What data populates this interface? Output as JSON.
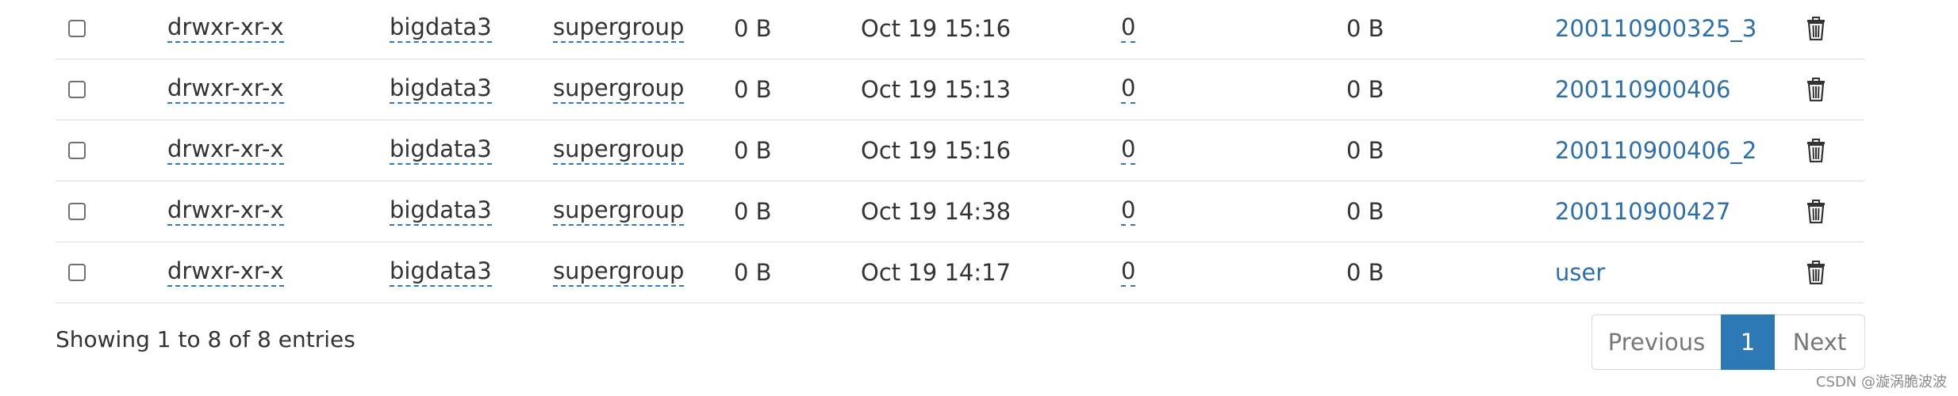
{
  "rows": [
    {
      "permission": "drwxr-xr-x",
      "owner": "bigdata3",
      "group": "supergroup",
      "size": "0 B",
      "modified": "Oct 19 15:16",
      "replication": "0",
      "block_size": "0 B",
      "name": "200110900325_3"
    },
    {
      "permission": "drwxr-xr-x",
      "owner": "bigdata3",
      "group": "supergroup",
      "size": "0 B",
      "modified": "Oct 19 15:13",
      "replication": "0",
      "block_size": "0 B",
      "name": "200110900406"
    },
    {
      "permission": "drwxr-xr-x",
      "owner": "bigdata3",
      "group": "supergroup",
      "size": "0 B",
      "modified": "Oct 19 15:16",
      "replication": "0",
      "block_size": "0 B",
      "name": "200110900406_2"
    },
    {
      "permission": "drwxr-xr-x",
      "owner": "bigdata3",
      "group": "supergroup",
      "size": "0 B",
      "modified": "Oct 19 14:38",
      "replication": "0",
      "block_size": "0 B",
      "name": "200110900427"
    },
    {
      "permission": "drwxr-xr-x",
      "owner": "bigdata3",
      "group": "supergroup",
      "size": "0 B",
      "modified": "Oct 19 14:17",
      "replication": "0",
      "block_size": "0 B",
      "name": "user"
    }
  ],
  "footer": {
    "info": "Showing 1 to 8 of 8 entries",
    "previous": "Previous",
    "current_page": "1",
    "next": "Next"
  },
  "watermark": "CSDN @漩涡脆波波",
  "colors": {
    "link": "#2f6fa8",
    "active_page": "#2f78b6",
    "border": "#dcdcdc"
  }
}
